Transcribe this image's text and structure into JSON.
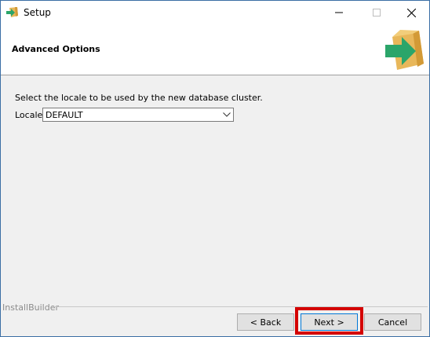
{
  "window": {
    "title": "Setup",
    "app_icon": "setup-box-arrow-icon"
  },
  "header": {
    "title": "Advanced Options",
    "icon": "box-arrow-icon"
  },
  "body": {
    "instruction": "Select the locale to be used by the new database cluster.",
    "locale_label": "Locale",
    "locale_value": "DEFAULT"
  },
  "footer": {
    "brand": "InstallBuilder",
    "back_label": "< Back",
    "next_label": "Next >",
    "cancel_label": "Cancel"
  },
  "colors": {
    "highlight": "#d40000",
    "arrow_green": "#2ba56a",
    "box_tan": "#e8b75a"
  }
}
